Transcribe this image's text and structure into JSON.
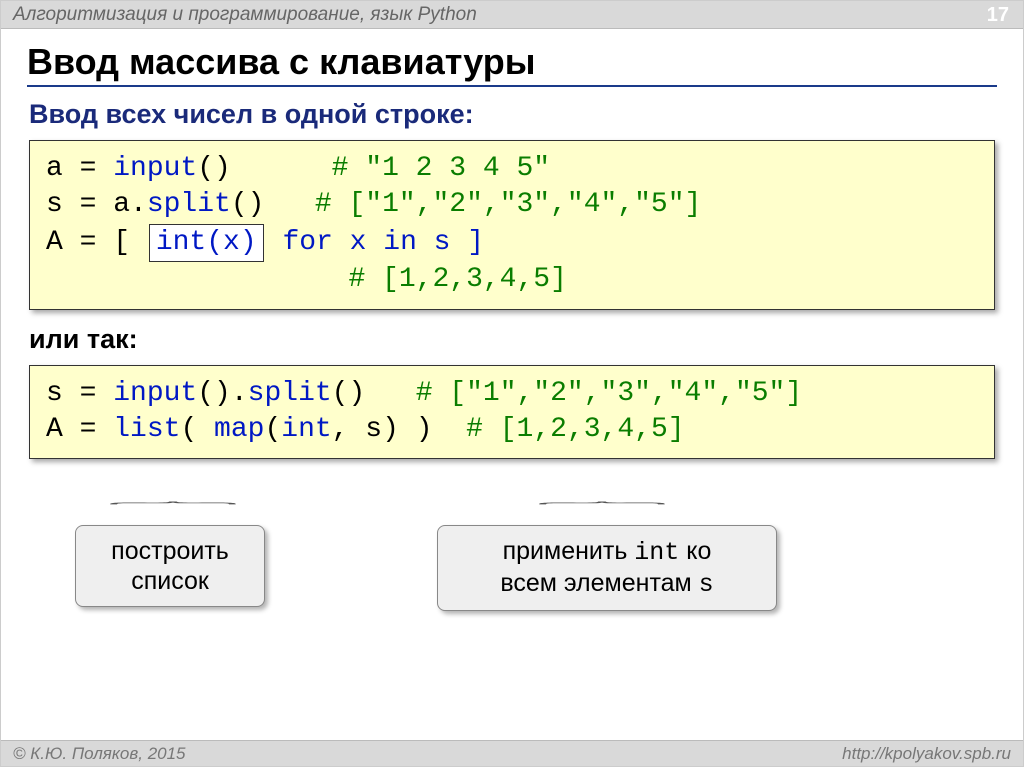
{
  "header": {
    "title": "Алгоритмизация и программирование, язык Python",
    "page": "17"
  },
  "main_title": "Ввод массива с клавиатуры",
  "subtitle": "Ввод всех чисел в одной строке:",
  "code1": {
    "l1_a": "a = ",
    "l1_input": "input",
    "l1_b": "()      ",
    "l1_c": "# \"1 2 3 4 5\"",
    "l2_a": "s = a.",
    "l2_split": "split",
    "l2_b": "()   ",
    "l2_c": "# [\"1\",\"2\",\"3\",\"4\",\"5\"]",
    "l3_a": "A = [ ",
    "l3_box": "int(x)",
    "l3_b": " for x in s ]",
    "l4_a": "                  ",
    "l4_c": "# [1,2,3,4,5]"
  },
  "or_text": "или так:",
  "code2": {
    "l1_a": "s = ",
    "l1_input": "input",
    "l1_b": "().",
    "l1_split": "split",
    "l1_c": "()   ",
    "l1_d": "# [\"1\",\"2\",\"3\",\"4\",\"5\"]",
    "l2_a": "A = ",
    "l2_list": "list",
    "l2_b": "( ",
    "l2_map": "map",
    "l2_c": "(",
    "l2_int": "int",
    "l2_d": ", s) )  ",
    "l2_e": "# [1,2,3,4,5]"
  },
  "callouts": {
    "left": "построить\nсписок",
    "right_a": "применить ",
    "right_b": "int",
    "right_c": " ко\nвсем элементам ",
    "right_d": "s"
  },
  "footer": {
    "left": "© К.Ю. Поляков, 2015",
    "right": "http://kpolyakov.spb.ru"
  }
}
